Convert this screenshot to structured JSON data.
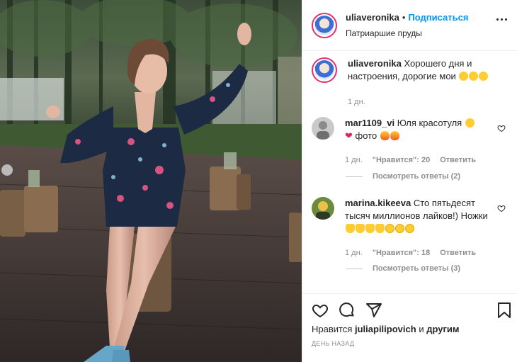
{
  "post": {
    "username": "uliaveronika",
    "dot": "•",
    "follow_label": "Подписаться",
    "location": "Патриаршие пруды"
  },
  "caption": {
    "username": "uliaveronika",
    "text": "Хорошего дня и настроения, дорогие мои",
    "time": "1 дн."
  },
  "comments": [
    {
      "username": "mar1109_vi",
      "text": "Юля красотуля",
      "text2": "фото",
      "time": "1 дн.",
      "likes": "\"Нравится\": 20",
      "reply": "Ответить",
      "view_replies": "Посмотреть ответы (2)"
    },
    {
      "username": "marina.kikeeva",
      "text": "Сто пятьдесят тысяч миллионов лайков!) Ножки",
      "time": "1 дн.",
      "likes": "\"Нравится\": 18",
      "reply": "Ответить",
      "view_replies": "Посмотреть ответы (3)"
    }
  ],
  "footer": {
    "likes_prefix": "Нравится",
    "liked_by": "juliapilipovich",
    "likes_and": "и",
    "likes_others": "другим",
    "timestamp": "День назад"
  },
  "icons": {
    "like": "heart-icon",
    "comment": "comment-icon",
    "share": "share-icon",
    "save": "bookmark-icon",
    "more": "more-icon"
  },
  "colors": {
    "follow": "#0095f6",
    "meta": "#8e8e8e",
    "text": "#262626",
    "avatar_ring": "#e1306c"
  }
}
